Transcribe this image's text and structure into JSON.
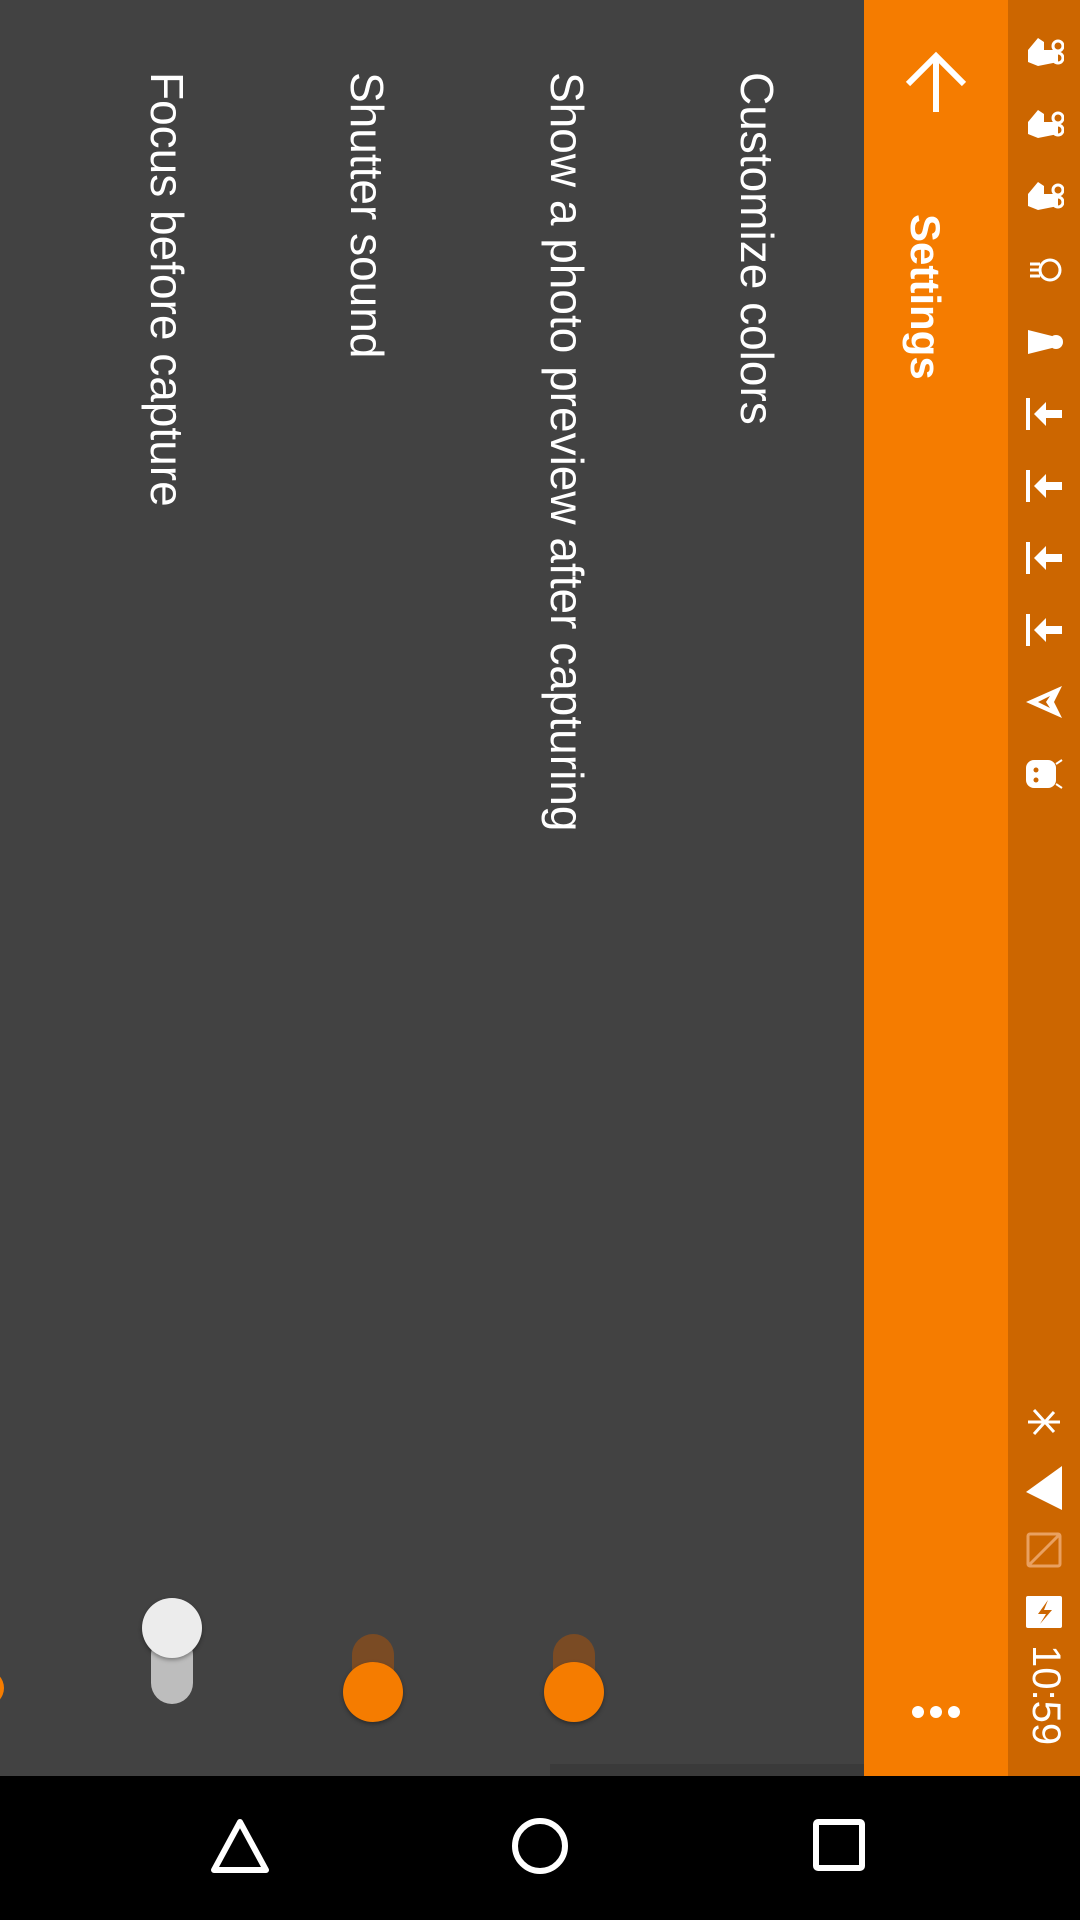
{
  "status_bar": {
    "time": "10:59",
    "left_icons": [
      "notification-hand-icon",
      "notification-hand-icon",
      "notification-hand-icon",
      "lightbulb-icon",
      "flashlight-icon",
      "download-icon",
      "download-icon",
      "download-icon",
      "download-icon",
      "send-icon",
      "android-icon"
    ],
    "right_icons": [
      "bluetooth-icon",
      "signal-icon",
      "sim-crossed-icon",
      "battery-charging-icon"
    ]
  },
  "app_bar": {
    "title": "Settings",
    "back_icon": "arrow-back-icon",
    "overflow_icon": "more-vert-icon"
  },
  "settings": [
    {
      "label": "Customize colors"
    },
    {
      "label": "Show a photo preview after capturing",
      "toggle": true
    },
    {
      "label": "Shutter sound",
      "toggle": true
    },
    {
      "label": "Focus before capture",
      "toggle": false
    }
  ],
  "nav_bar": {
    "buttons": [
      "back-triangle-icon",
      "home-circle-icon",
      "recents-square-icon"
    ]
  },
  "colors": {
    "accent": "#f57c00",
    "status_bar": "#cc6600",
    "background": "#424242"
  }
}
